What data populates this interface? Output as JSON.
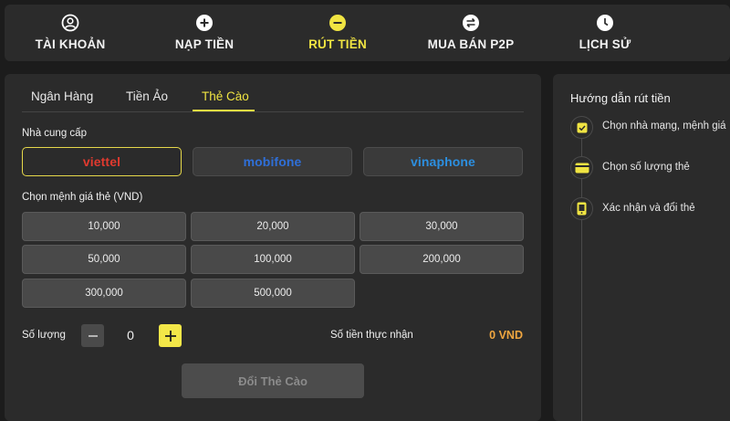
{
  "nav": [
    {
      "label": "TÀI KHOẢN",
      "icon": "account-icon"
    },
    {
      "label": "NẠP TIỀN",
      "icon": "plus-circle-icon"
    },
    {
      "label": "RÚT TIỀN",
      "icon": "minus-circle-icon",
      "active": true
    },
    {
      "label": "MUA BÁN P2P",
      "icon": "exchange-icon"
    },
    {
      "label": "LỊCH SỬ",
      "icon": "clock-icon"
    }
  ],
  "tabs": [
    {
      "label": "Ngân Hàng"
    },
    {
      "label": "Tiền Ảo"
    },
    {
      "label": "Thẻ Cào",
      "active": true
    }
  ],
  "provider_label": "Nhà cung cấp",
  "providers": [
    {
      "name": "viettel",
      "color": "#e03a2f",
      "active": true
    },
    {
      "name": "mobifone",
      "color": "#2f6fd8"
    },
    {
      "name": "vinaphone",
      "color": "#2c8fe0"
    }
  ],
  "denomination_label": "Chọn mệnh giá thẻ (VND)",
  "denominations": [
    "10,000",
    "20,000",
    "30,000",
    "50,000",
    "100,000",
    "200,000",
    "300,000",
    "500,000"
  ],
  "quantity": {
    "label": "Số lượng",
    "value": "0"
  },
  "receive": {
    "label": "Số tiền thực nhận",
    "value": "0 VND"
  },
  "submit_label": "Đổi Thẻ Cào",
  "guide": {
    "title": "Hướng dẫn rút tiền",
    "steps": [
      {
        "text": "Chọn nhà mạng, mệnh giá",
        "icon": "check-card-icon"
      },
      {
        "text": "Chọn số lượng thẻ",
        "icon": "card-icon"
      },
      {
        "text": "Xác nhận và đổi thẻ",
        "icon": "phone-icon"
      }
    ]
  },
  "colors": {
    "accent": "#f0e442",
    "panel": "#2b2b2b",
    "background": "#1c1c1c",
    "amount": "#f0a640"
  }
}
